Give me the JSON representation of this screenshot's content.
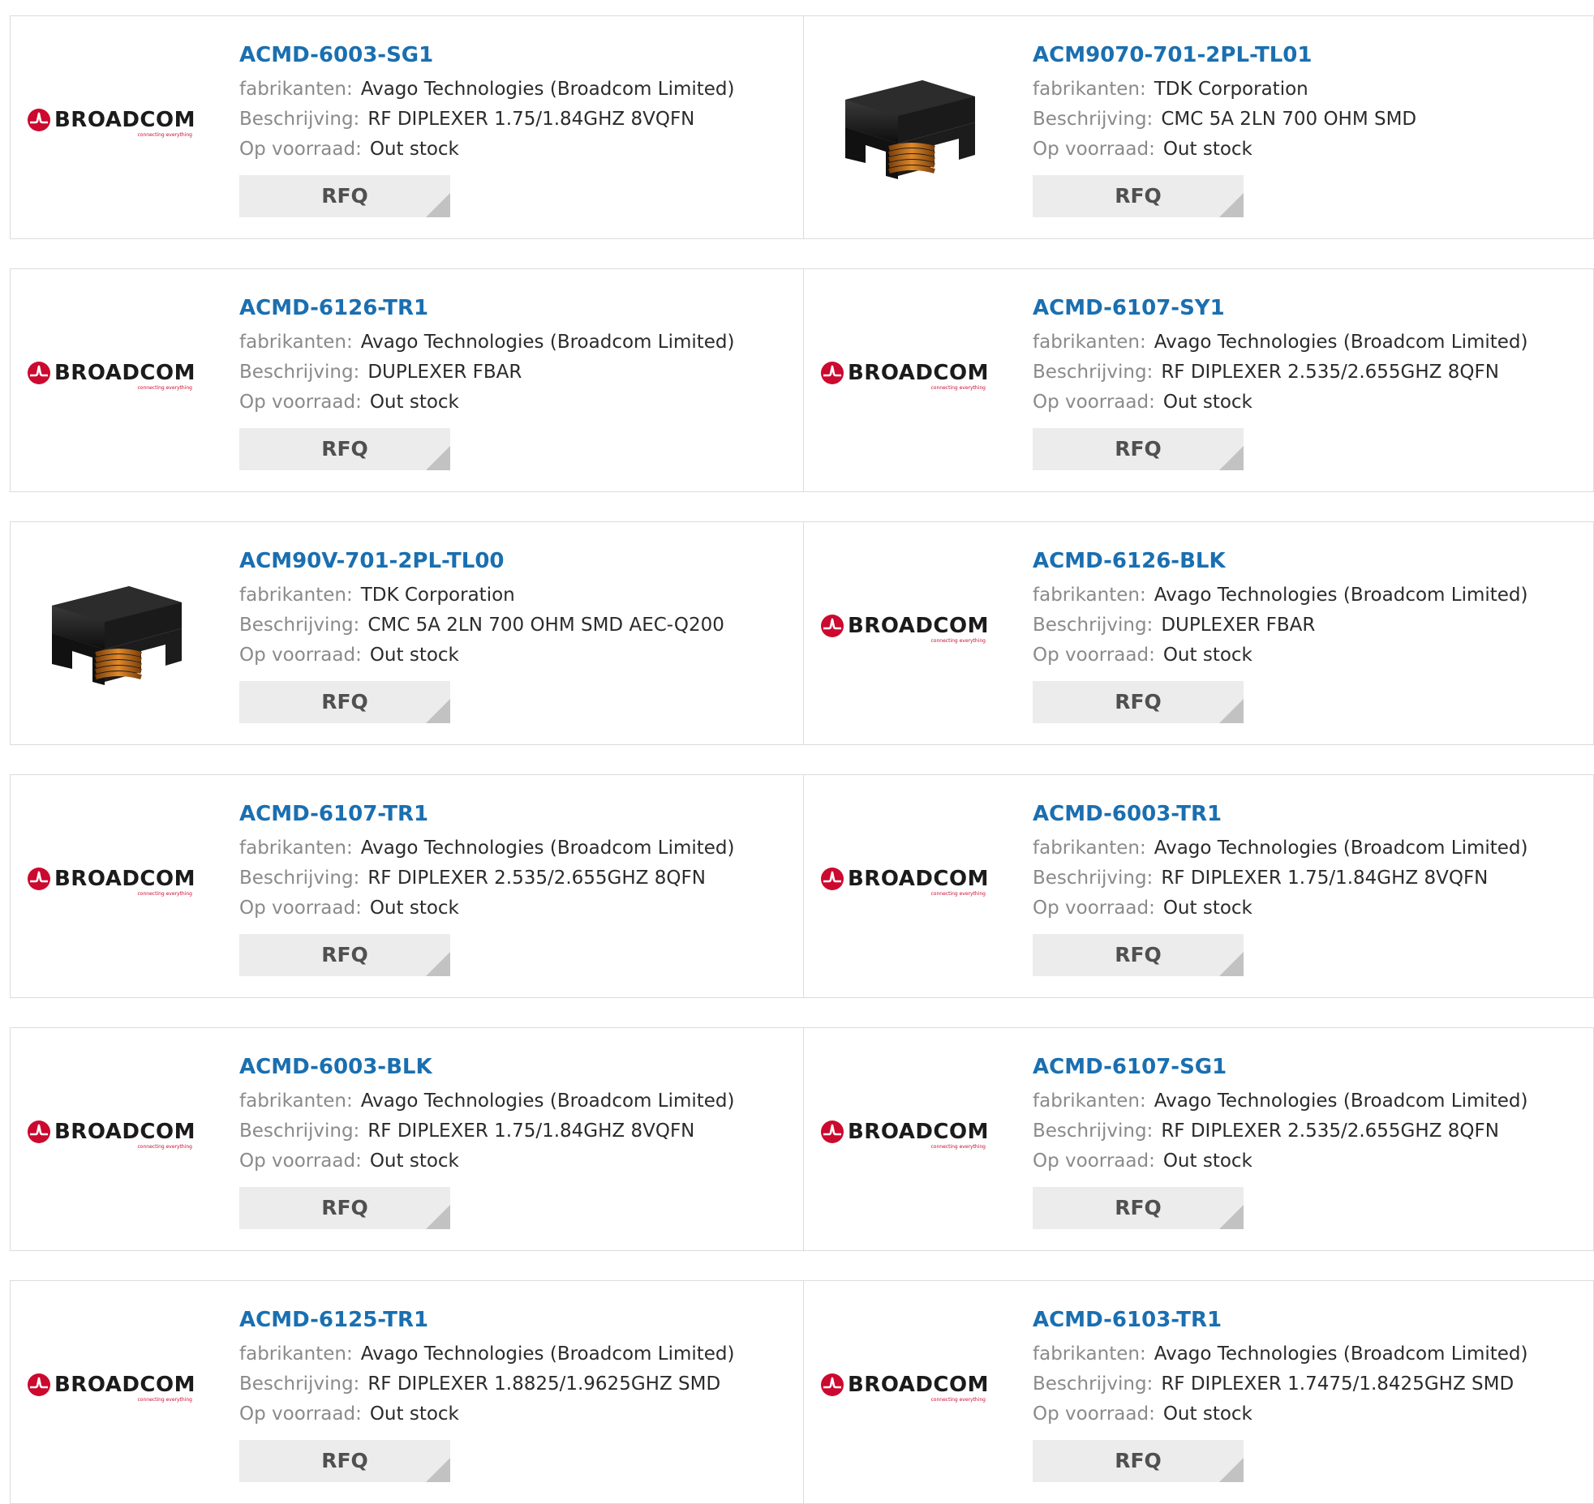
{
  "labels": {
    "manufacturer": "fabrikanten:",
    "description": "Beschrijving:",
    "stock": "Op voorraad:",
    "rfq": "RFQ"
  },
  "logo": {
    "word": "BROADCOM",
    "tagline": "connecting everything",
    "brand_color": "#cc092f"
  },
  "colors": {
    "link": "#1a6fb0",
    "label": "#8a8a8a",
    "value": "#2b2b2b",
    "button_bg": "#ececec"
  },
  "products": [
    {
      "part": "ACMD-6003-SG1",
      "image": "broadcom-logo",
      "manufacturer": "Avago Technologies (Broadcom Limited)",
      "description": "RF DIPLEXER 1.75/1.84GHZ 8VQFN",
      "stock": "Out stock"
    },
    {
      "part": "ACM9070-701-2PL-TL01",
      "image": "choke-photo",
      "manufacturer": "TDK Corporation",
      "description": "CMC 5A 2LN 700 OHM SMD",
      "stock": "Out stock"
    },
    {
      "part": "ACMD-6126-TR1",
      "image": "broadcom-logo",
      "manufacturer": "Avago Technologies (Broadcom Limited)",
      "description": "DUPLEXER FBAR",
      "stock": "Out stock"
    },
    {
      "part": "ACMD-6107-SY1",
      "image": "broadcom-logo",
      "manufacturer": "Avago Technologies (Broadcom Limited)",
      "description": "RF DIPLEXER 2.535/2.655GHZ 8QFN",
      "stock": "Out stock"
    },
    {
      "part": "ACM90V-701-2PL-TL00",
      "image": "choke-photo",
      "manufacturer": "TDK Corporation",
      "description": "CMC 5A 2LN 700 OHM SMD AEC-Q200",
      "stock": "Out stock"
    },
    {
      "part": "ACMD-6126-BLK",
      "image": "broadcom-logo",
      "manufacturer": "Avago Technologies (Broadcom Limited)",
      "description": "DUPLEXER FBAR",
      "stock": "Out stock"
    },
    {
      "part": "ACMD-6107-TR1",
      "image": "broadcom-logo",
      "manufacturer": "Avago Technologies (Broadcom Limited)",
      "description": "RF DIPLEXER 2.535/2.655GHZ 8QFN",
      "stock": "Out stock"
    },
    {
      "part": "ACMD-6003-TR1",
      "image": "broadcom-logo",
      "manufacturer": "Avago Technologies (Broadcom Limited)",
      "description": "RF DIPLEXER 1.75/1.84GHZ 8VQFN",
      "stock": "Out stock"
    },
    {
      "part": "ACMD-6003-BLK",
      "image": "broadcom-logo",
      "manufacturer": "Avago Technologies (Broadcom Limited)",
      "description": "RF DIPLEXER 1.75/1.84GHZ 8VQFN",
      "stock": "Out stock"
    },
    {
      "part": "ACMD-6107-SG1",
      "image": "broadcom-logo",
      "manufacturer": "Avago Technologies (Broadcom Limited)",
      "description": "RF DIPLEXER 2.535/2.655GHZ 8QFN",
      "stock": "Out stock"
    },
    {
      "part": "ACMD-6125-TR1",
      "image": "broadcom-logo",
      "manufacturer": "Avago Technologies (Broadcom Limited)",
      "description": "RF DIPLEXER 1.8825/1.9625GHZ SMD",
      "stock": "Out stock"
    },
    {
      "part": "ACMD-6103-TR1",
      "image": "broadcom-logo",
      "manufacturer": "Avago Technologies (Broadcom Limited)",
      "description": "RF DIPLEXER 1.7475/1.8425GHZ SMD",
      "stock": "Out stock"
    }
  ]
}
